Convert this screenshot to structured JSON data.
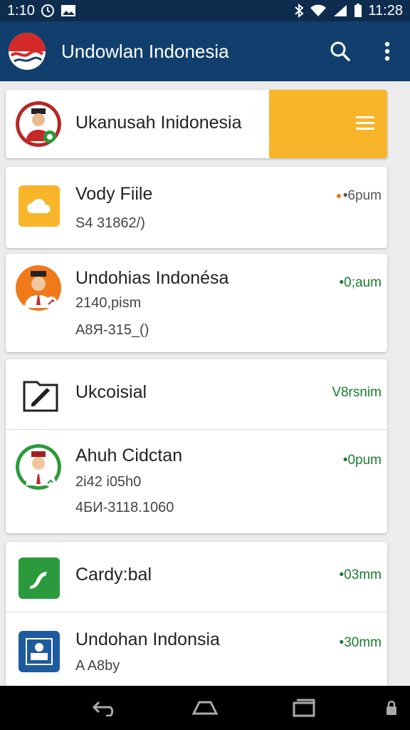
{
  "status_bar": {
    "time_left": "1:10",
    "time_right": "11:28",
    "icons": [
      "clock-icon",
      "image-icon",
      "bluetooth-icon",
      "wifi-icon",
      "signal-icon",
      "battery-icon"
    ]
  },
  "app_bar": {
    "title": "Undowlan Indonesia",
    "actions": [
      "search-icon",
      "more-vert-icon"
    ]
  },
  "items": [
    {
      "title": "Ukanusah Inidonesia",
      "icon": "person-avatar",
      "panel_icon": "menu-icon"
    },
    {
      "title": "Vody Fiile",
      "subtitle": "S4 31862/)",
      "meta": "•6pum",
      "icon": "cloud-icon",
      "accent": "#f8b52a"
    },
    {
      "title": "Undohias Indonésa",
      "subtitle": "2140,pism",
      "subtitle2": "A8Я-315_()",
      "meta": "•0;aum",
      "icon": "person-avatar"
    },
    {
      "title": "Ukcoisial",
      "meta": "V8rsnim",
      "icon": "edit-icon"
    },
    {
      "title": "Ahuh Cidctan",
      "subtitle": "2i42 i05h0",
      "subtitle2": "4БИ-3118.1060",
      "meta": "•0pum",
      "icon": "person-avatar"
    },
    {
      "title": "Cardy:bal",
      "meta": "•03mm",
      "icon": "map-icon",
      "accent": "#2b9a3c"
    },
    {
      "title": "Undohan Indonsia",
      "subtitle": "A A8by",
      "meta": "•30mm",
      "icon": "stamp-icon",
      "accent": "#1e5a9e"
    }
  ],
  "nav_bar": [
    "back-icon",
    "home-icon",
    "recents-icon",
    "lock-icon"
  ],
  "colors": {
    "app_bar": "#113f6d",
    "status_bar": "#0d2c4e",
    "accent_orange": "#f8b52a",
    "meta_green": "#1b7a2e"
  }
}
